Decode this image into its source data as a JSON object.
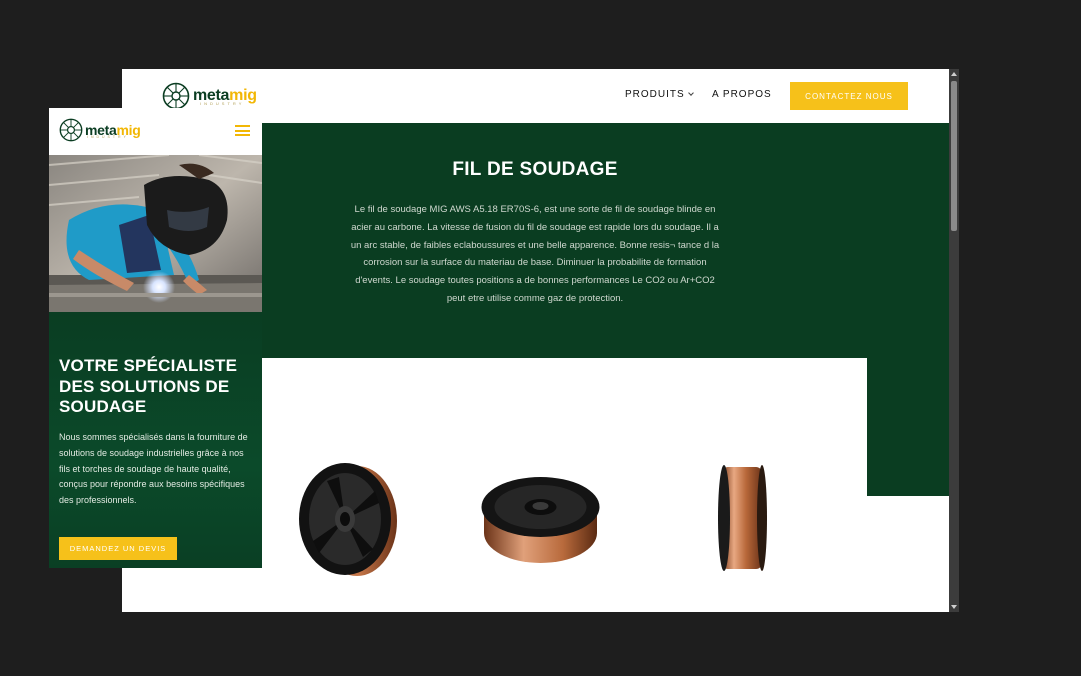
{
  "desktop": {
    "logo": {
      "text_a": "meta",
      "text_b": "mig",
      "subtitle": "INDUSTRY"
    },
    "nav": {
      "products": "PRODUITS",
      "about": "A PROPOS",
      "contact": "CONTACTEZ NOUS"
    },
    "hero": {
      "title": "FIL DE SOUDAGE",
      "description": "Le fil de soudage MIG AWS A5.18 ER70S-6, est une sorte de fil de soudage blinde en acier au carbone. La vitesse de fusion du fil de soudage est rapide lors du soudage. Il a un arc stable, de faibles eclaboussures et une belle apparence. Bonne resis¬ tance d la corrosion sur la surface du materiau de base. Diminuer la probabilite de formation d'events. Le soudage toutes positions a de bonnes performances Le CO2 ou Ar+CO2 peut etre utilise comme gaz de protection."
    },
    "products": [
      "spool-with-spokes",
      "spool-with-flanges",
      "spool-side-view"
    ]
  },
  "mobile": {
    "logo": {
      "text_a": "meta",
      "text_b": "mig",
      "subtitle": "INDUSTRY"
    },
    "title": "VOTRE SPÉCIALISTE DES SOLUTIONS DE SOUDAGE",
    "description": "Nous sommes spécialisés dans la fourniture de solutions de soudage industrielles grâce à nos fils et torches de soudage de haute qualité, conçus pour répondre aux besoins spécifiques des professionnels.",
    "cta": "DEMANDEZ UN DEVIS"
  },
  "colors": {
    "brand_green": "#0a3d21",
    "brand_yellow": "#f6c11a",
    "backdrop": "#1e1e1e"
  }
}
